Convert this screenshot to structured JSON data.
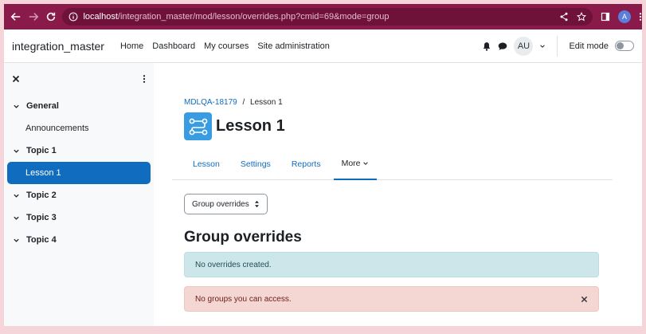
{
  "browser": {
    "url_host": "localhost",
    "url_path": "/integration_master/mod/lesson/overrides.php?cmid=69&mode=group",
    "profile_initial": "A"
  },
  "navbar": {
    "site_name": "integration_master",
    "links": [
      "Home",
      "Dashboard",
      "My courses",
      "Site administration"
    ],
    "avatar": "AU",
    "edit_mode_label": "Edit mode",
    "edit_mode_on": false
  },
  "sidebar": {
    "sections": [
      {
        "label": "General",
        "items": [
          "Announcements"
        ]
      },
      {
        "label": "Topic 1",
        "items": [
          "Lesson 1"
        ]
      },
      {
        "label": "Topic 2",
        "items": []
      },
      {
        "label": "Topic 3",
        "items": []
      },
      {
        "label": "Topic 4",
        "items": []
      }
    ],
    "active_item": "Lesson 1"
  },
  "main": {
    "breadcrumb": {
      "course": "MDLQA-18179",
      "separator": "/",
      "current": "Lesson 1"
    },
    "title": "Lesson 1",
    "tabs": [
      "Lesson",
      "Settings",
      "Reports",
      "More"
    ],
    "active_tab": "More",
    "overrides_select": "Group overrides",
    "heading": "Group overrides",
    "info_alert": "No overrides created.",
    "error_alert": "No groups you can access."
  },
  "colors": {
    "browser_chrome": "#8a1a4a",
    "primary": "#0f6cbf",
    "lesson_icon": "#399be2",
    "info_bg": "#cce6ea",
    "error_bg": "#f4d6d2"
  }
}
